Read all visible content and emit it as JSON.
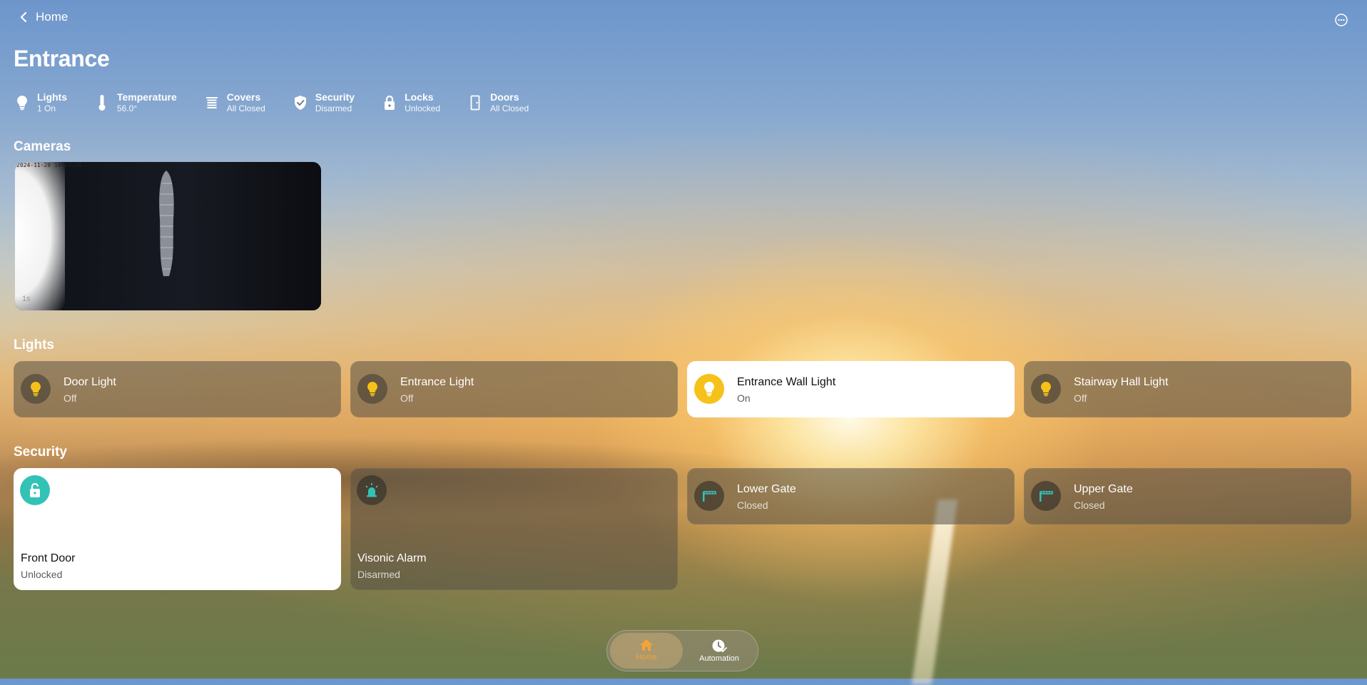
{
  "header": {
    "back_label": "Home",
    "title": "Entrance"
  },
  "summary": [
    {
      "title": "Lights",
      "value": "1 On",
      "icon": "lightbulb-icon"
    },
    {
      "title": "Temperature",
      "value": "56.0°",
      "icon": "thermometer-icon"
    },
    {
      "title": "Covers",
      "value": "All Closed",
      "icon": "blinds-icon"
    },
    {
      "title": "Security",
      "value": "Disarmed",
      "icon": "shield-check-icon"
    },
    {
      "title": "Locks",
      "value": "Unlocked",
      "icon": "lock-icon"
    },
    {
      "title": "Doors",
      "value": "All Closed",
      "icon": "door-icon"
    }
  ],
  "sections": {
    "cameras": "Cameras",
    "lights": "Lights",
    "security": "Security"
  },
  "camera": {
    "stamp": "2024-11-20 14:27:41",
    "label": "1s"
  },
  "lights": [
    {
      "name": "Door Light",
      "state": "Off",
      "icon": "lightbulb-icon"
    },
    {
      "name": "Entrance Light",
      "state": "Off",
      "icon": "lightbulb-icon"
    },
    {
      "name": "Entrance Wall Light",
      "state": "On",
      "icon": "lightbulb-icon"
    },
    {
      "name": "Stairway Hall Light",
      "state": "Off",
      "icon": "lightbulb-icon"
    }
  ],
  "security": [
    {
      "name": "Front Door",
      "state": "Unlocked",
      "icon": "lock-open-icon"
    },
    {
      "name": "Visonic Alarm",
      "state": "Disarmed",
      "icon": "siren-icon"
    },
    {
      "name": "Lower Gate",
      "state": "Closed",
      "icon": "gate-icon"
    },
    {
      "name": "Upper Gate",
      "state": "Closed",
      "icon": "gate-icon"
    }
  ],
  "nav": {
    "home_label": "Home",
    "automation_label": "Automation"
  },
  "colors": {
    "accent_on": "#f6c21a",
    "teal": "#33c2b6",
    "nav_active": "#f1a33b"
  }
}
